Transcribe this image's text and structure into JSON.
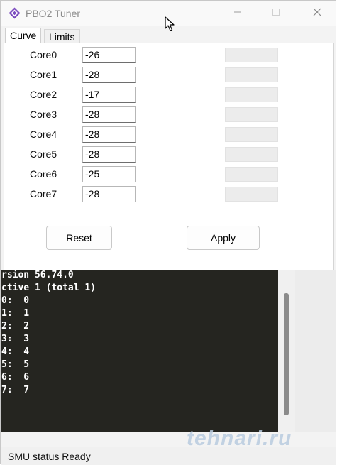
{
  "window": {
    "title": "PBO2 Tuner",
    "accent": "#7b4bbf"
  },
  "tabs": [
    {
      "label": "Curve"
    },
    {
      "label": "Limits"
    }
  ],
  "cores": [
    {
      "label": "Core0",
      "value": "-26"
    },
    {
      "label": "Core1",
      "value": "-28"
    },
    {
      "label": "Core2",
      "value": "-17"
    },
    {
      "label": "Core3",
      "value": "-28"
    },
    {
      "label": "Core4",
      "value": "-28"
    },
    {
      "label": "Core5",
      "value": "-28"
    },
    {
      "label": "Core6",
      "value": "-25"
    },
    {
      "label": "Core7",
      "value": "-28"
    }
  ],
  "buttons": {
    "reset": "Reset",
    "apply": "Apply"
  },
  "console": {
    "lines": [
      "rsion 56.74.0",
      "ctive 1 (total 1)",
      "0:  0",
      "1:  1",
      "2:  2",
      "3:  3",
      "4:  4",
      "5:  5",
      "6:  6",
      "7:  7"
    ]
  },
  "watermark": "tehnari.ru",
  "status": {
    "text": "SMU status Ready"
  }
}
